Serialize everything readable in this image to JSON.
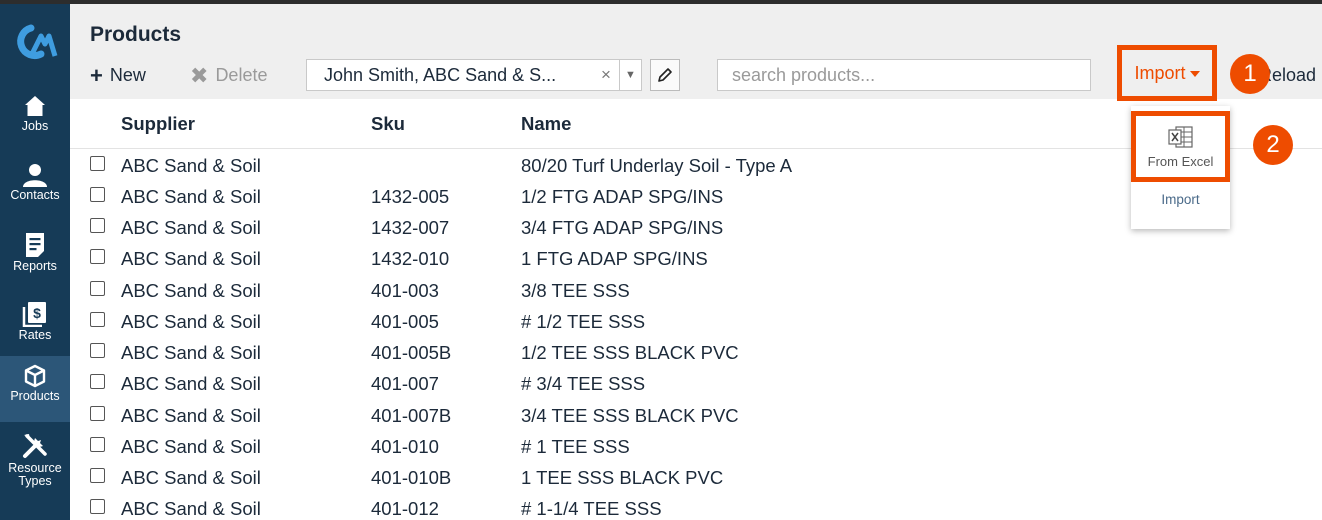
{
  "sidebar": {
    "items": [
      {
        "label": "Jobs",
        "icon": "home-icon"
      },
      {
        "label": "Contacts",
        "icon": "person-icon"
      },
      {
        "label": "Reports",
        "icon": "report-icon"
      },
      {
        "label": "Rates",
        "icon": "rates-icon"
      },
      {
        "label": "Products",
        "icon": "box-icon"
      },
      {
        "label": "Resource Types",
        "icon": "tools-icon"
      }
    ],
    "active": "Products"
  },
  "header": {
    "title": "Products",
    "new_label": "New",
    "delete_label": "Delete",
    "supplier_value": "John Smith, ABC Sand & S...",
    "clear_glyph": "×",
    "search_placeholder": "search products...",
    "import_label": "Import",
    "reload_label": "Reload"
  },
  "steps": {
    "one": "1",
    "two": "2"
  },
  "dropdown": {
    "from_excel_label": "From Excel",
    "import_label": "Import"
  },
  "table": {
    "columns": [
      "Supplier",
      "Sku",
      "Name"
    ],
    "rows": [
      {
        "supplier": "ABC Sand & Soil",
        "sku": "",
        "name": "80/20 Turf Underlay Soil - Type A"
      },
      {
        "supplier": "ABC Sand & Soil",
        "sku": "1432-005",
        "name": "1/2 FTG ADAP SPG/INS"
      },
      {
        "supplier": "ABC Sand & Soil",
        "sku": "1432-007",
        "name": "3/4 FTG ADAP SPG/INS"
      },
      {
        "supplier": "ABC Sand & Soil",
        "sku": "1432-010",
        "name": "1 FTG ADAP SPG/INS"
      },
      {
        "supplier": "ABC Sand & Soil",
        "sku": "401-003",
        "name": "3/8 TEE SSS"
      },
      {
        "supplier": "ABC Sand & Soil",
        "sku": "401-005",
        "name": "# 1/2 TEE SSS"
      },
      {
        "supplier": "ABC Sand & Soil",
        "sku": "401-005B",
        "name": "1/2 TEE SSS BLACK PVC"
      },
      {
        "supplier": "ABC Sand & Soil",
        "sku": "401-007",
        "name": "# 3/4 TEE SSS"
      },
      {
        "supplier": "ABC Sand & Soil",
        "sku": "401-007B",
        "name": "3/4 TEE SSS BLACK PVC"
      },
      {
        "supplier": "ABC Sand & Soil",
        "sku": "401-010",
        "name": "# 1 TEE SSS"
      },
      {
        "supplier": "ABC Sand & Soil",
        "sku": "401-010B",
        "name": "1 TEE SSS BLACK PVC"
      },
      {
        "supplier": "ABC Sand & Soil",
        "sku": "401-012",
        "name": "# 1-1/4 TEE SSS"
      }
    ]
  },
  "colors": {
    "accent": "#ee4c00",
    "sidebar": "#163b57",
    "sidebar_active": "#2c5678"
  }
}
